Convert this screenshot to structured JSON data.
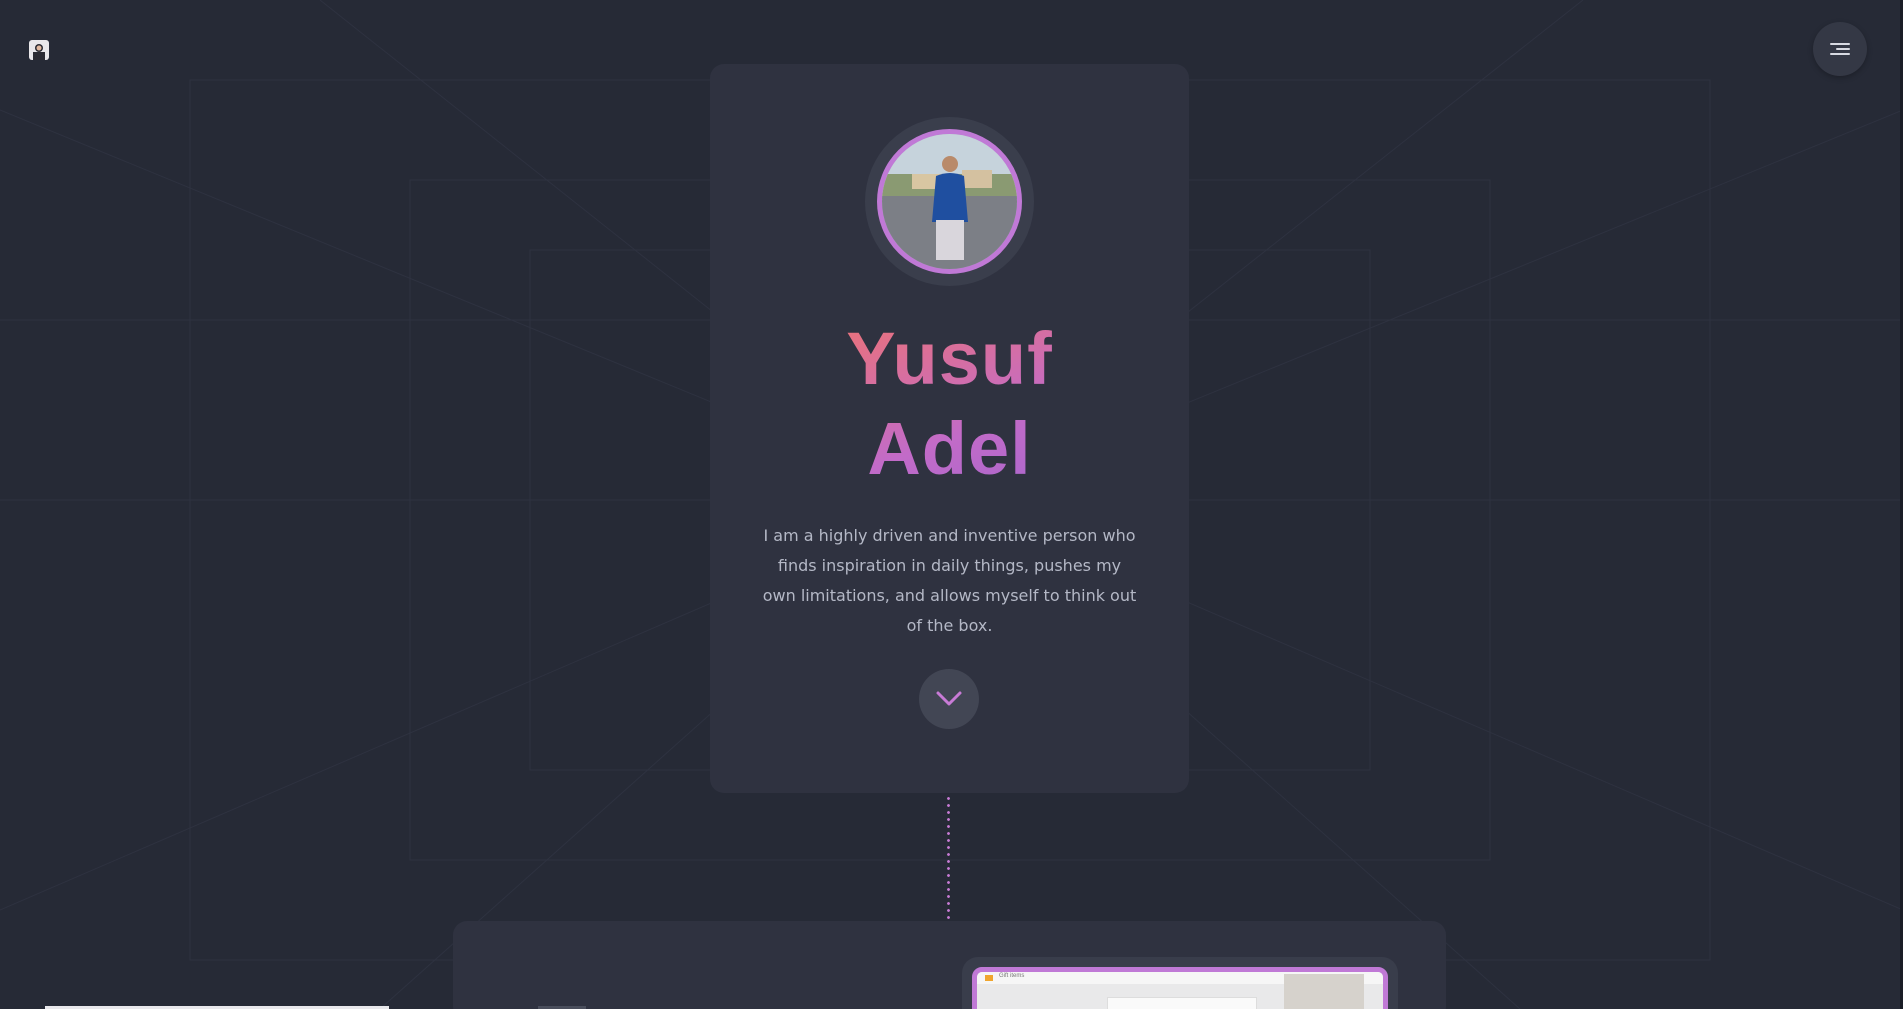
{
  "header": {
    "logo_icon": "profile-logo-icon",
    "menu_icon": "hamburger-menu-icon"
  },
  "hero": {
    "first_name": "Yusuf",
    "last_name": "Adel",
    "bio": "I am a highly driven and inventive person who finds inspiration in daily things, pushes my own limitations, and allows myself to think out of the box.",
    "scroll_icon": "chevron-down-icon",
    "avatar_icon": "profile-photo"
  },
  "next_section": {
    "preview_caption": "Gift items"
  },
  "colors": {
    "background": "#262a36",
    "card": "#2f3240",
    "accent": "#c079d6",
    "gradient_start": "#f0736f",
    "gradient_end": "#9b63cf",
    "text_muted": "#b4b8c6"
  }
}
